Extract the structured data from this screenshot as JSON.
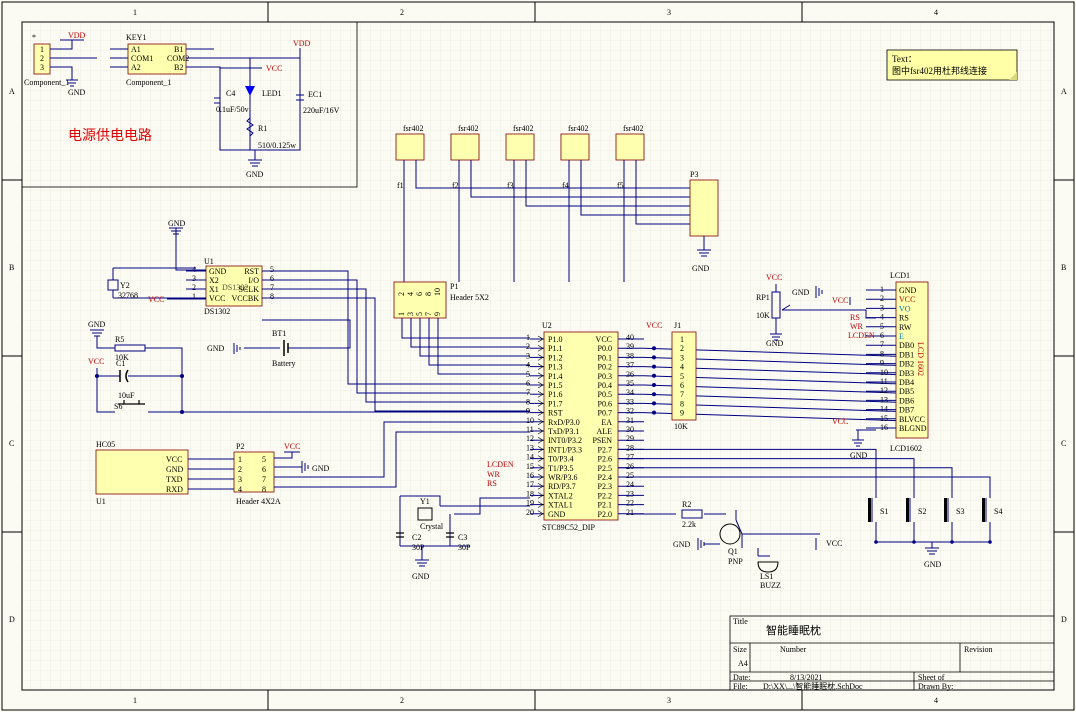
{
  "border": {
    "columns": [
      "1",
      "2",
      "3",
      "4"
    ],
    "rows": [
      "A",
      "B",
      "C",
      "D"
    ]
  },
  "note": {
    "line1": "Text：",
    "line2": "图中fsr402用杜邦线连接"
  },
  "power": {
    "title": "电源供电电路",
    "conn_ref": "*",
    "conn_name": "Component_1",
    "key_ref": "KEY1",
    "key_name": "Component_1",
    "key_pins": [
      "A1",
      "COM1",
      "A2",
      "B1",
      "COM2",
      "B2"
    ],
    "vdd1": "VDD",
    "vdd2": "VDD",
    "gnd": "GND",
    "gnd2": "GND",
    "vcc": "VCC",
    "c4": "C4",
    "c4_val": "0.1uF/50v",
    "led": "LED1",
    "ec1": "EC1",
    "ec1_val": "220uF/16V",
    "r1": "R1",
    "r1_val": "510/0.125w",
    "conn_pins": [
      "1",
      "2",
      "3"
    ]
  },
  "fsr": {
    "labels": [
      "fsr402",
      "fsr402",
      "fsr402",
      "fsr402",
      "fsr402"
    ],
    "nets": [
      "f1",
      "f2",
      "f3",
      "f4",
      "f5"
    ],
    "p3": "P3",
    "gnd": "GND"
  },
  "p1": {
    "ref": "P1",
    "name": "Header 5X2",
    "top_pins": [
      "2",
      "4",
      "6",
      "8",
      "10"
    ],
    "bot_pins": [
      "1",
      "3",
      "5",
      "7",
      "9"
    ]
  },
  "rtc": {
    "ref": "U1",
    "name": "DS1302",
    "overlap": "DS1302",
    "pins_left": [
      "GND",
      "X2",
      "X1",
      "VCC"
    ],
    "pins_right": [
      "RST",
      "I/O",
      "SCLK",
      "VCCBK"
    ],
    "num_left": [
      "4",
      "3",
      "2",
      "1"
    ],
    "num_right": [
      "5",
      "6",
      "7",
      "8"
    ],
    "gnd": "GND",
    "vcc": "VCC",
    "crystal_ref": "Y2",
    "crystal_val": "32768"
  },
  "battery": {
    "ref": "BT1",
    "name": "Battery",
    "gnd": "GND"
  },
  "reset": {
    "gnd": "GND",
    "r5": "R5",
    "r5_val": "10K",
    "vcc": "VCC",
    "c1": "C1",
    "c1_val": "10uF",
    "s6": "S6"
  },
  "mcu": {
    "ref": "U2",
    "name": "STC89C52_DIP",
    "left_pins": [
      "P1.0",
      "P1.1",
      "P1.2",
      "P1.3",
      "P1.4",
      "P1.5",
      "P1.6",
      "P1.7",
      "RST",
      "RxD/P3.0",
      "TxD/P3.1",
      "INT0/P3.2",
      "INT1/P3.3",
      "T0/P3.4",
      "T1/P3.5",
      "WR/P3.6",
      "RD/P3.7",
      "XTAL2",
      "XTAL1",
      "GND"
    ],
    "right_pins": [
      "VCC",
      "P0.0",
      "P0.1",
      "P0.2",
      "P0.3",
      "P0.4",
      "P0.5",
      "P0.6",
      "P0.7",
      "EA",
      "ALE",
      "PSEN",
      "P2.7",
      "P2.6",
      "P2.5",
      "P2.4",
      "P2.3",
      "P2.2",
      "P2.1",
      "P2.0"
    ],
    "left_nums": [
      "1",
      "2",
      "3",
      "4",
      "5",
      "6",
      "7",
      "8",
      "9",
      "10",
      "11",
      "12",
      "13",
      "14",
      "15",
      "16",
      "17",
      "18",
      "19",
      "20"
    ],
    "right_nums": [
      "40",
      "39",
      "38",
      "37",
      "36",
      "35",
      "34",
      "33",
      "32",
      "31",
      "30",
      "29",
      "28",
      "27",
      "26",
      "25",
      "24",
      "23",
      "22",
      "21"
    ],
    "nets": [
      "LCDEN",
      "WR",
      "RS"
    ]
  },
  "j1": {
    "ref": "J1",
    "vcc": "VCC",
    "val": "10K",
    "pins": [
      "1",
      "2",
      "3",
      "4",
      "5",
      "6",
      "7",
      "8",
      "9"
    ]
  },
  "lcd": {
    "ref": "LCD1",
    "name": "LCD1602",
    "side": "LCD 1602",
    "pins": [
      "GND",
      "VCC",
      "VO",
      "RS",
      "RW",
      "E",
      "DB0",
      "DB1",
      "DB2",
      "DB3",
      "DB4",
      "DB5",
      "DB6",
      "DB7",
      "BLVCC",
      "BLGND"
    ],
    "nums": [
      "1",
      "2",
      "3",
      "4",
      "5",
      "6",
      "7",
      "8",
      "9",
      "10",
      "11",
      "12",
      "13",
      "14",
      "15",
      "16"
    ],
    "nets": [
      "RS",
      "WR",
      "LCDEN"
    ],
    "gnd": "GND",
    "vcc": "VCC",
    "vcc2": "VCC",
    "gnd2": "GND",
    "rp1": "RP1",
    "rp1_val": "10K",
    "rp_vcc": "VCC",
    "rp_gnd": "GND"
  },
  "bt": {
    "ref": "U1",
    "name": "HC05",
    "pins": [
      "VCC",
      "GND",
      "TXD",
      "RXD"
    ],
    "p2": "P2",
    "p2_name": "Header 4X2A",
    "p2_left": [
      "1",
      "2",
      "3",
      "4"
    ],
    "p2_right": [
      "5",
      "6",
      "7",
      "8"
    ],
    "vcc": "VCC",
    "gnd": "GND"
  },
  "xtal": {
    "ref": "Y1",
    "name": "Crystal",
    "c2": "C2",
    "c2_val": "30P",
    "c3": "C3",
    "c3_val": "30P",
    "gnd": "GND"
  },
  "buzzer": {
    "r2": "R2",
    "r2_val": "2.2k",
    "gnd": "GND",
    "q1": "Q1",
    "q1_type": "PNP",
    "vcc": "VCC",
    "ls1": "LS1",
    "ls1_name": "BUZZ"
  },
  "keys": {
    "labels": [
      "S1",
      "S2",
      "S3",
      "S4"
    ],
    "gnd": "GND"
  },
  "titleblock": {
    "title_label": "Title",
    "title": "智能睡眠枕",
    "size_label": "Size",
    "size": "A4",
    "number_label": "Number",
    "revision_label": "Revision",
    "date_label": "Date:",
    "date": "8/13/2021",
    "sheet_label": "Sheet    of",
    "file_label": "File:",
    "file": "D:\\XX\\...\\智能睡眠枕.SchDoc",
    "drawn_label": "Drawn By:"
  }
}
